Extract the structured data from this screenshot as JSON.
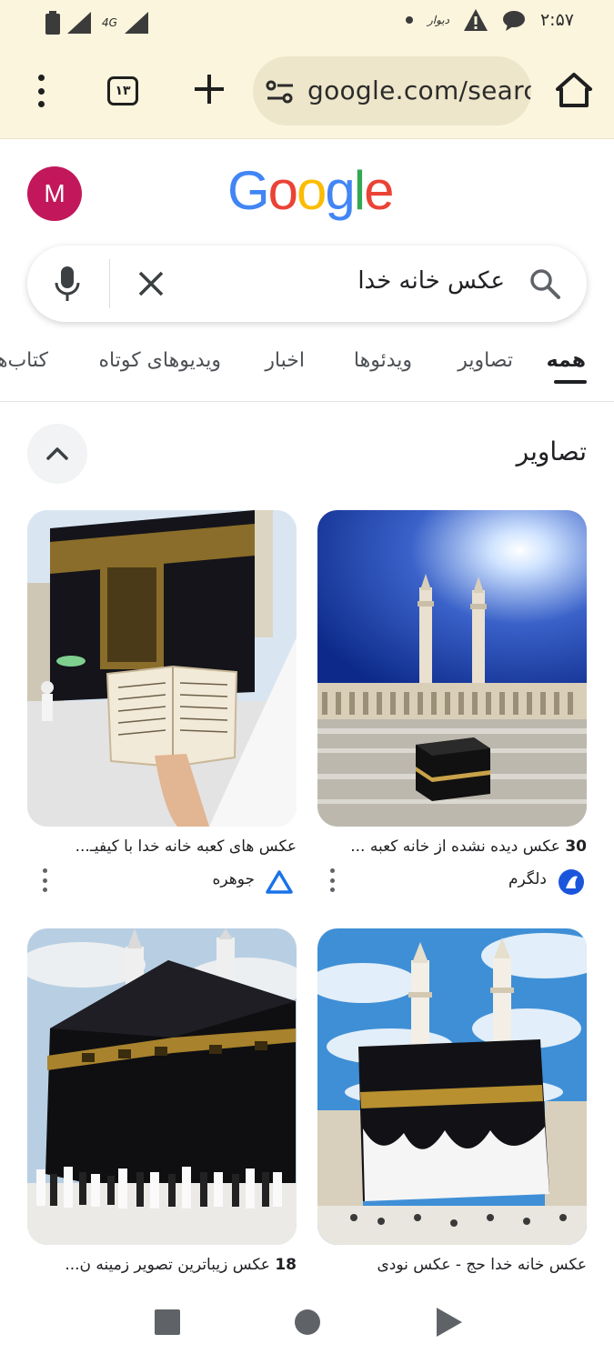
{
  "status_bar": {
    "time": "۲:۵۷",
    "app_notification": "دیوار",
    "network": "4G"
  },
  "toolbar": {
    "tab_count": "۱۳",
    "url": "google.com/search"
  },
  "google": {
    "avatar_letter": "M",
    "logo": "Google"
  },
  "search": {
    "query": "عکس خانه خدا"
  },
  "tabs": [
    "همه",
    "تصاویر",
    "ویدئوها",
    "اخبار",
    "ویدیوهای کوتاه",
    "کتاب‌ها"
  ],
  "section": {
    "title": "تصاویر"
  },
  "results": [
    {
      "number": "30",
      "caption": " عکس دیده نشده از خانه کعبه ...",
      "source": "دلگرم",
      "source_color": "#1a73e8"
    },
    {
      "number": "",
      "caption": "عکس های کعبه خانه خدا با کیفیـ...",
      "source": "جوهره",
      "source_color": "#1a73e8"
    },
    {
      "number": "",
      "caption": "عکس خانه خدا حج - عکس نودی",
      "source": "",
      "source_color": ""
    },
    {
      "number": "18",
      "caption": " عکس زیباترین تصویر زمینه ن...",
      "source": "",
      "source_color": ""
    }
  ]
}
